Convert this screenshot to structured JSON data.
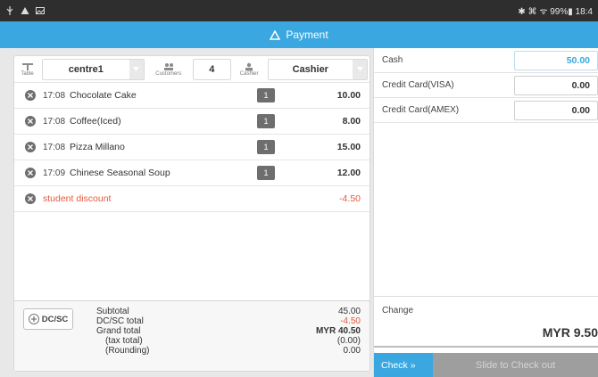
{
  "status_bar": {
    "left_icons": [
      "usb-icon",
      "warning-icon",
      "image-icon"
    ],
    "right_text": "✱ ⌘ ᯤ 99%▮ 18:4"
  },
  "header": {
    "title": "Payment",
    "icon": "triangle-icon",
    "color": "#3ba7e0"
  },
  "selectors": {
    "table": {
      "label": "Table",
      "value": "centre1"
    },
    "customers": {
      "label": "Customers",
      "value": "4"
    },
    "cashier": {
      "label": "Cashier",
      "value": "Cashier"
    }
  },
  "orders": [
    {
      "time": "17:08",
      "name": "Chocolate Cake",
      "qty": "1",
      "price": "10.00"
    },
    {
      "time": "17:08",
      "name": "Coffee(Iced)",
      "qty": "1",
      "price": "8.00"
    },
    {
      "time": "17:08",
      "name": "Pizza Millano",
      "qty": "1",
      "price": "15.00"
    },
    {
      "time": "17:09",
      "name": "Chinese Seasonal Soup",
      "qty": "1",
      "price": "12.00"
    }
  ],
  "discount": {
    "name": "student discount",
    "price": "-4.50",
    "color": "#e45a3d"
  },
  "totals": {
    "button_label": "DC/SC",
    "subtotal_label": "Subtotal",
    "subtotal": "45.00",
    "dcsc_label": "DC/SC total",
    "dcsc": "-4.50",
    "grand_label": "Grand total",
    "grand": "MYR 40.50",
    "tax_label": "(tax total)",
    "tax": "(0.00)",
    "rounding_label": "(Rounding)",
    "rounding": "0.00"
  },
  "payments": [
    {
      "label": "Cash",
      "value": "50.00"
    },
    {
      "label": "Credit Card(VISA)",
      "value": "0.00"
    },
    {
      "label": "Credit Card(AMEX)",
      "value": "0.00"
    }
  ],
  "change": {
    "label": "Change",
    "value": "MYR 9.50"
  },
  "checkout": {
    "check_label": "Check",
    "chevrons": "»",
    "slide_label": "Slide to Check out"
  }
}
